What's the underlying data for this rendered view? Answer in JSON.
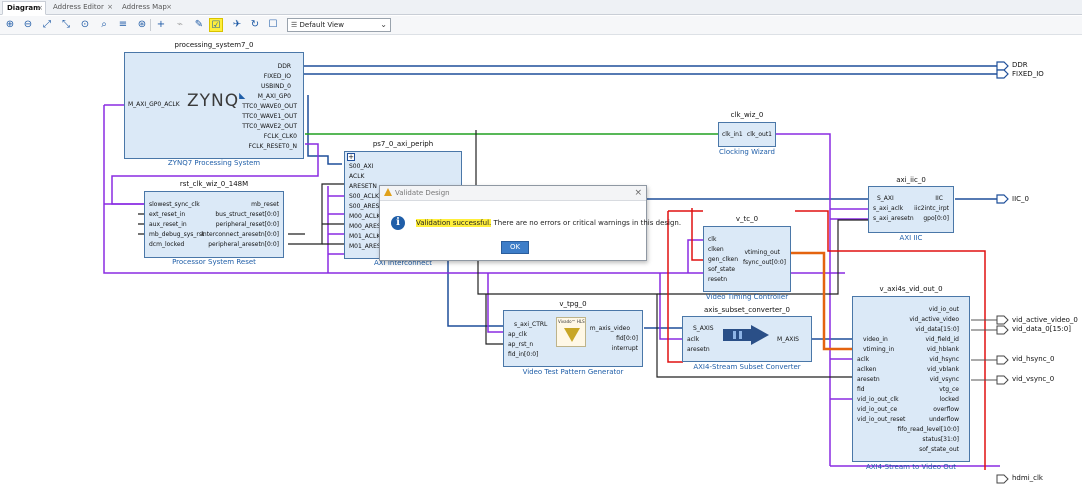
{
  "tabs": [
    {
      "label": "Diagram",
      "active": true
    },
    {
      "label": "Address Editor",
      "active": false
    },
    {
      "label": "Address Map",
      "active": false
    }
  ],
  "toolbar": {
    "icons": [
      "zoom-in-icon",
      "zoom-out-icon",
      "zoom-fit-icon",
      "fit-selection-icon",
      "auto-fit-icon",
      "search-icon",
      "collapse-icon",
      "regenerate-layout-icon",
      "add-ip-icon",
      "connect-icon",
      "properties-icon",
      "validate-design-icon",
      "run-connection-automation-icon",
      "refresh-icon",
      "optimize-routing-icon"
    ],
    "view_selector": "Default View"
  },
  "ips": {
    "ps7": {
      "name": "processing_system7_0",
      "subtitle": "ZYNQ7 Processing System",
      "logo": "ZYNQ",
      "left_pins": [
        "M_AXI_GP0_ACLK"
      ],
      "right_pins": [
        "DDR",
        "FIXED_IO",
        "USBIND_0",
        "M_AXI_GP0",
        "TTC0_WAVE0_OUT",
        "TTC0_WAVE1_OUT",
        "TTC0_WAVE2_OUT",
        "FCLK_CLK0",
        "FCLK_RESET0_N"
      ]
    },
    "rst": {
      "name": "rst_clk_wiz_0_148M",
      "subtitle": "Processor System Reset",
      "left_pins": [
        "slowest_sync_clk",
        "ext_reset_in",
        "aux_reset_in",
        "mb_debug_sys_rst",
        "dcm_locked"
      ],
      "right_pins": [
        "mb_reset",
        "bus_struct_reset[0:0]",
        "peripheral_reset[0:0]",
        "interconnect_aresetn[0:0]",
        "peripheral_aresetn[0:0]"
      ]
    },
    "interconnect": {
      "name": "ps7_0_axi_periph",
      "subtitle": "AXI Interconnect",
      "left_pins": [
        "S00_AXI",
        "ACLK",
        "ARESETN",
        "S00_ACLK",
        "S00_ARESETN",
        "M00_ACLK",
        "M00_ARESETN",
        "M01_ACLK",
        "M01_ARESETN"
      ]
    },
    "clkwiz": {
      "name": "clk_wiz_0",
      "subtitle": "Clocking Wizard",
      "left_pins": [
        "clk_in1"
      ],
      "right_pins": [
        "clk_out1"
      ]
    },
    "iic": {
      "name": "axi_iic_0",
      "subtitle": "AXI IIC",
      "left_pins": [
        "S_AXI",
        "s_axi_aclk",
        "s_axi_aresetn"
      ],
      "right_pins": [
        "IIC",
        "iic2intc_irpt",
        "gpo[0:0]"
      ]
    },
    "vtc": {
      "name": "v_tc_0",
      "subtitle": "Video Timing Controller",
      "left_pins": [
        "clk",
        "clken",
        "gen_clken",
        "sof_state",
        "resetn"
      ],
      "right_pins": [
        "vtiming_out",
        "fsync_out[0:0]"
      ]
    },
    "tpg": {
      "name": "v_tpg_0",
      "subtitle": "Video Test Pattern Generator",
      "logo": "Vivado™ HLS",
      "left_pins": [
        "s_axi_CTRL",
        "ap_clk",
        "ap_rst_n",
        "fid_in[0:0]"
      ],
      "right_pins": [
        "m_axis_video",
        "fid[0:0]",
        "interrupt"
      ]
    },
    "subset": {
      "name": "axis_subset_converter_0",
      "subtitle": "AXI4-Stream Subset Converter",
      "left_pins": [
        "S_AXIS",
        "aclk",
        "aresetn"
      ],
      "right_pins": [
        "M_AXIS"
      ]
    },
    "vidout": {
      "name": "v_axi4s_vid_out_0",
      "subtitle": "AXI4-Stream to Video Out",
      "left_pins": [
        "video_in",
        "vtiming_in",
        "aclk",
        "aclken",
        "aresetn",
        "fid",
        "vid_io_out_clk",
        "vid_io_out_ce",
        "vid_io_out_reset"
      ],
      "right_pins": [
        "vid_io_out",
        "vid_active_video",
        "vid_data[15:0]",
        "vid_field_id",
        "vid_hblank",
        "vid_hsync",
        "vid_vblank",
        "vid_vsync",
        "vtg_ce",
        "locked",
        "overflow",
        "underflow",
        "fifo_read_level[10:0]",
        "status[31:0]",
        "sof_state_out"
      ]
    }
  },
  "external_ports": [
    "DDR",
    "FIXED_IO",
    "IIC_0",
    "vid_active_video_0",
    "vid_data_0[15:0]",
    "vid_hsync_0",
    "vid_vsync_0",
    "hdmi_clk"
  ],
  "dialog": {
    "title": "Validate Design",
    "highlight": "Validation successful.",
    "message": " There are no errors or critical warnings in this design.",
    "ok_label": "OK"
  },
  "colors": {
    "clock": "#20a020",
    "reset": "#8a2be2",
    "bus": "#1f4f9a",
    "video": "#e4630f",
    "highlight_red": "#e01010"
  }
}
